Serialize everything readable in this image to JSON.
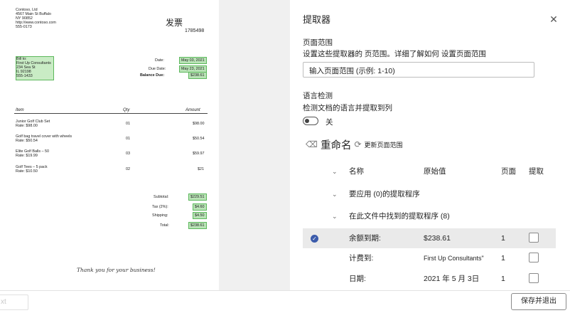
{
  "document": {
    "company_lines": [
      "Contoso, Ltd",
      "4567 Main St Buffalo",
      "NY 90852",
      "http://www.contoso.com",
      "555-0173"
    ],
    "title": "发票",
    "invoice_number": "1785498",
    "bill_to_lines": [
      "Bill to:",
      "First Up Consultants",
      "234 Sea St",
      "IL 92198",
      "555-1433"
    ],
    "date_label": "Date:",
    "date_value": "May 03, 2021",
    "due_label": "Due Date:",
    "due_value": "May 23, 2021",
    "balance_label": "Balance Due:",
    "balance_value": "$238.61",
    "headers": {
      "item": "Item",
      "qty": "Qty",
      "amount": "Amount"
    },
    "items": [
      {
        "name": "Junior Golf Club Set",
        "rate": "Rate: $98.00",
        "qty": "01",
        "amount": "$98.00"
      },
      {
        "name": "Golf bag travel cover with wheels",
        "rate": "Rate: $50.54",
        "qty": "01",
        "amount": "$50.54"
      },
      {
        "name": "Elite Golf Balls – 50",
        "rate": "Rate: $19.99",
        "qty": "03",
        "amount": "$59.97"
      },
      {
        "name": "Golf Tees – 5 pack",
        "rate": "Rate: $10.50",
        "qty": "02",
        "amount": "$21"
      }
    ],
    "subtotal_label": "Subtotal:",
    "subtotal_value": "$229.51",
    "tax_label": "Tax (2%):",
    "tax_value": "$4.60",
    "shipping_label": "Shipping:",
    "shipping_value": "$4.50",
    "total_label": "Total:",
    "total_value": "$238.61",
    "thanks": "Thank you for your business!"
  },
  "panel": {
    "title": "提取器",
    "close_icon": "close-icon",
    "page_range_heading": "页面范围",
    "page_range_desc": "设置这些提取器的 页范围。详细了解如何 设置页面范围",
    "page_range_placeholder": "输入页面范围 (示例: 1-10)",
    "lang_heading": "语言检测",
    "lang_desc": "检测文档的语言并提取到列",
    "toggle_label": "关",
    "toggle_on": false,
    "rename_label": "重命名",
    "update_label": "更新页面范围",
    "columns": {
      "name": "名称",
      "original": "原始值",
      "page": "页面",
      "extract": "提取"
    },
    "groups": [
      {
        "label": "要应用 (0)的提取程序"
      },
      {
        "label": "在此文件中找到的提取程序 (8)"
      }
    ],
    "rows": [
      {
        "name": "余额到期:",
        "value": "$238.61",
        "page": "1",
        "selected": true
      },
      {
        "name": "计费到:",
        "value": "First Up Consultants\"",
        "page": "1",
        "selected": false
      },
      {
        "name": "日期:",
        "value": "2021 年 5 月 3日",
        "page": "1",
        "selected": false
      }
    ]
  },
  "footer": {
    "ghost_label": "xt",
    "save_label": "保存并退出"
  }
}
